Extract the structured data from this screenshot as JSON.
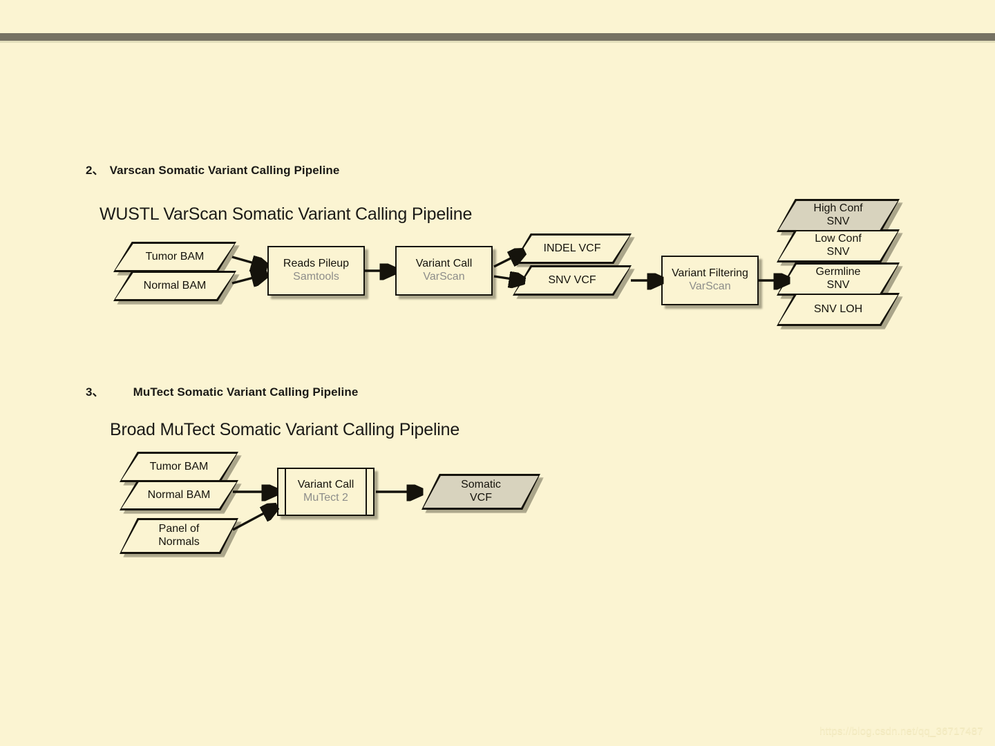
{
  "page": {
    "background_color": "#fbf4d2",
    "top_bar_color": "#767263",
    "top_bar_underline_color": "#e3dfbc"
  },
  "watermark": {
    "text": "https://blog.csdn.net/qq_36717487"
  },
  "sections": [
    {
      "number": "2、",
      "title": "Varscan Somatic Variant Calling Pipeline"
    },
    {
      "number": "3、",
      "title": "MuTect Somatic Variant Calling Pipeline"
    }
  ],
  "diagram_varscan": {
    "title": "WUSTL VarScan Somatic Variant Calling Pipeline",
    "nodes": {
      "tumor_bam": {
        "primary": "Tumor BAM",
        "secondary": ""
      },
      "normal_bam": {
        "primary": "Normal BAM",
        "secondary": ""
      },
      "reads_pileup": {
        "primary": "Reads Pileup",
        "secondary": "Samtools"
      },
      "variant_call": {
        "primary": "Variant Call",
        "secondary": "VarScan"
      },
      "indel_vcf": {
        "primary": "INDEL VCF",
        "secondary": ""
      },
      "snv_vcf": {
        "primary": "SNV VCF",
        "secondary": ""
      },
      "variant_filtering": {
        "primary": "Variant Filtering",
        "secondary": "VarScan"
      },
      "high_conf_snv": {
        "primary": "High Conf",
        "secondary": "SNV",
        "highlight_color": "#d8d3be"
      },
      "low_conf_snv": {
        "primary": "Low Conf",
        "secondary": "SNV"
      },
      "germline_snv": {
        "primary": "Germline",
        "secondary": "SNV"
      },
      "snv_loh": {
        "primary": "SNV LOH",
        "secondary": ""
      }
    }
  },
  "diagram_mutect": {
    "title": "Broad MuTect Somatic Variant Calling Pipeline",
    "nodes": {
      "tumor_bam": {
        "primary": "Tumor BAM",
        "secondary": ""
      },
      "normal_bam": {
        "primary": "Normal BAM",
        "secondary": ""
      },
      "panel_of_normals": {
        "primary": "Panel of",
        "secondary": "Normals"
      },
      "variant_call": {
        "primary": "Variant Call",
        "secondary": "MuTect 2"
      },
      "somatic_vcf": {
        "primary": "Somatic",
        "secondary": "VCF",
        "highlight_color": "#d8d3be"
      }
    }
  }
}
